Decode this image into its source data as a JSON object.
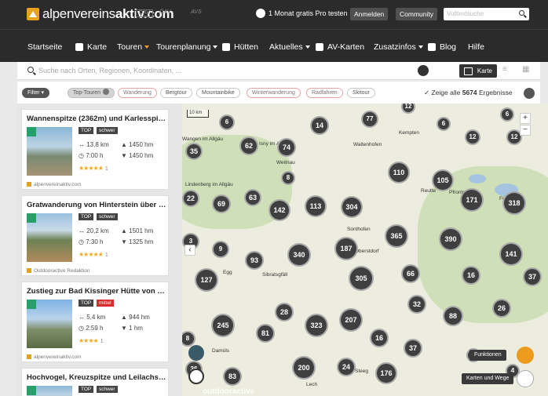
{
  "header": {
    "logo_regular": "alpenvereins",
    "logo_bold": "aktiv.com",
    "partners": [
      "DAV",
      "ÖAV",
      "AVS"
    ],
    "pro_label": "1 Monat gratis Pro testen",
    "login_label": "Anmelden",
    "community_label": "Community",
    "fulltext_placeholder": "Volltextsuche"
  },
  "nav": {
    "items": [
      {
        "label": "Startseite",
        "icon": "",
        "caret": false
      },
      {
        "label": "Karte",
        "icon": "map-icon",
        "caret": false
      },
      {
        "label": "Touren",
        "icon": "",
        "caret": true,
        "caret_color": "#f0a030"
      },
      {
        "label": "Tourenplanung",
        "icon": "",
        "caret": true
      },
      {
        "label": "Hütten",
        "icon": "hut-icon",
        "caret": false
      },
      {
        "label": "Aktuelles",
        "icon": "",
        "caret": true
      },
      {
        "label": "AV-Karten",
        "icon": "map-sheet-icon",
        "caret": false
      },
      {
        "label": "Zusatzinfos",
        "icon": "",
        "caret": true
      },
      {
        "label": "Blog",
        "icon": "blog-icon",
        "caret": false
      },
      {
        "label": "Hilfe",
        "icon": "",
        "caret": false
      }
    ]
  },
  "search": {
    "placeholder": "Suche nach Orten, Regionen, Koordinaten, ...",
    "view_map_label": "Karte"
  },
  "filters": {
    "filter_label": "Filter",
    "chips": [
      "Top-Touren",
      "Wanderung",
      "Bergtour",
      "Mountainbike",
      "Winterwanderung",
      "Radfahren",
      "Skitour"
    ],
    "show_all_prefix": "Zeige alle",
    "result_count": "5674",
    "show_all_suffix": "Ergebnisse"
  },
  "tours": [
    {
      "title": "Wannenspitze (2362m) und Karlesspitz...",
      "top": "TOP",
      "difficulty": "schwer",
      "difficulty_color": "#444444",
      "distance": "13,8 km",
      "ascent": "1450 hm",
      "duration": "7:00 h",
      "descent": "1450 hm",
      "stars": "★★★★★",
      "rating_count": "1",
      "source": "alpenvereinaktiv.com"
    },
    {
      "title": "Gratwanderung von Hinterstein über 2 ...",
      "top": "TOP",
      "difficulty": "schwer",
      "difficulty_color": "#444444",
      "distance": "20,2 km",
      "ascent": "1501 hm",
      "duration": "7:30 h",
      "descent": "1325 hm",
      "stars": "★★★★★",
      "rating_count": "1",
      "source": "Outdooractive Redaktion"
    },
    {
      "title": "Zustieg zur Bad Kissinger Hütte von Pfr...",
      "top": "TOP",
      "difficulty": "mittel",
      "difficulty_color": "#d92b2b",
      "distance": "5,4 km",
      "ascent": "944 hm",
      "duration": "2:59 h",
      "descent": "1 hm",
      "stars": "★★★★",
      "rating_count": "1",
      "source": "alpenvereinaktiv.com"
    },
    {
      "title": "Hochvogel, Kreuzspitze und Leilachspit...",
      "top": "TOP",
      "difficulty": "schwer",
      "difficulty_color": "#444444"
    }
  ],
  "map": {
    "scale_label": "10 km",
    "places": [
      "Isny im Allgäu",
      "Wangen im Allgäu",
      "Weitnau",
      "Waltenhofen",
      "Lindenberg im Allgäu",
      "Kempten",
      "Sonthofen",
      "Oberstdorf",
      "Damüls",
      "Egg",
      "Sibratsgfäll",
      "Steeg",
      "Reutte",
      "Pfronten",
      "Füssen",
      "Lech"
    ],
    "clusters": [
      "6",
      "14",
      "77",
      "6",
      "12",
      "6",
      "35",
      "62",
      "74",
      "12",
      "12",
      "8",
      "110",
      "105",
      "22",
      "69",
      "63",
      "142",
      "113",
      "304",
      "171",
      "318",
      "3",
      "9",
      "93",
      "340",
      "187",
      "365",
      "390",
      "141",
      "127",
      "305",
      "66",
      "16",
      "37",
      "28",
      "32",
      "88",
      "26",
      "245",
      "81",
      "323",
      "207",
      "16",
      "8",
      "37",
      "200",
      "24",
      "176",
      "8",
      "36",
      "83",
      "4"
    ],
    "legend_functions": "Funktionen",
    "legend_layers": "Karten und Wege",
    "watermark": "outdooractive"
  }
}
